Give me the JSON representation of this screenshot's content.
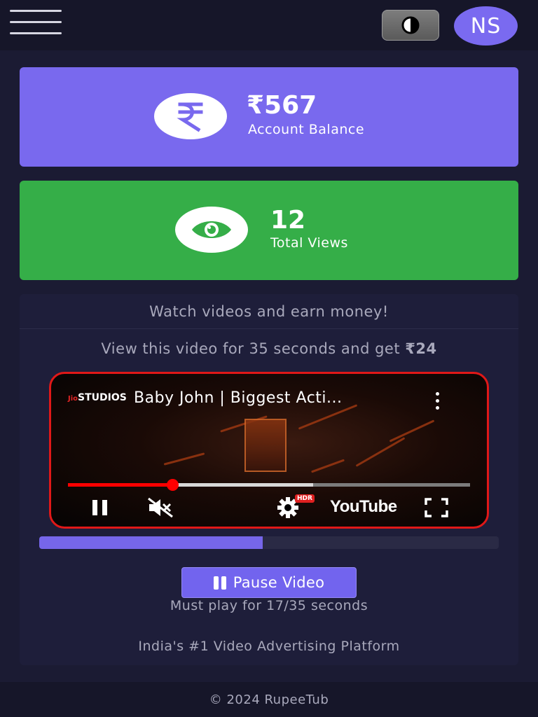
{
  "header": {
    "menu_icon": "hamburger-icon",
    "theme_icon": "contrast-icon",
    "avatar_initials": "NS"
  },
  "balance": {
    "value": "₹567",
    "label": "Account Balance",
    "icon": "rupee-icon",
    "color": "#7969ee"
  },
  "views": {
    "value": "12",
    "label": "Total Views",
    "icon": "eye-icon",
    "color": "#35ae48"
  },
  "earn": {
    "heading": "Watch videos and earn money!",
    "instruction_prefix": "View this video for 35 seconds and get ",
    "instruction_reward": "₹24"
  },
  "player": {
    "channel_jio": "Jio",
    "channel_name": "STUDIOS",
    "title": "Baby John | Biggest Acti...",
    "hdr_badge": "HDR",
    "youtube_label": "YouTube",
    "played_fraction": 0.26,
    "buffered_fraction": 0.61,
    "accent": "#ff0000"
  },
  "watch_progress": {
    "fraction": 0.486,
    "color": "#7666ea"
  },
  "pause_button": {
    "label": "Pause Video"
  },
  "timer_text": "Must play for 17/35 seconds",
  "tagline": "India's #1 Video Advertising Platform",
  "footer": {
    "copyright": "© 2024 RupeeTub"
  }
}
